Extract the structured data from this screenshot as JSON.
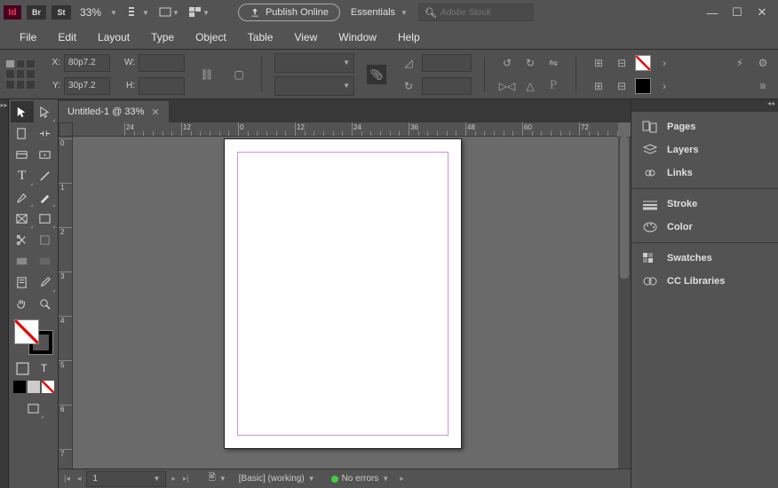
{
  "titlebar": {
    "app_id": "Id",
    "badge_br": "Br",
    "badge_st": "St",
    "zoom": "33%",
    "publish_label": "Publish Online",
    "workspace": "Essentials",
    "stock_placeholder": "Adobe Stock"
  },
  "menu": [
    "File",
    "Edit",
    "Layout",
    "Type",
    "Object",
    "Table",
    "View",
    "Window",
    "Help"
  ],
  "control": {
    "x_label": "X:",
    "y_label": "Y:",
    "w_label": "W:",
    "h_label": "H:",
    "x_value": "80p7.2",
    "y_value": "30p7.2",
    "w_value": "",
    "h_value": ""
  },
  "document": {
    "tab_title": "Untitled-1 @ 33%",
    "ruler_h_labels": [
      "24",
      "12",
      "0",
      "12",
      "24",
      "36",
      "48",
      "60",
      "72"
    ],
    "ruler_v_labels": [
      "0",
      "1",
      "2",
      "3",
      "4",
      "5",
      "6",
      "7"
    ]
  },
  "status": {
    "page_num": "1",
    "preflight": "[Basic] (working)",
    "errors": "No errors"
  },
  "panels": {
    "group1": [
      "Pages",
      "Layers",
      "Links"
    ],
    "group2": [
      "Stroke",
      "Color"
    ],
    "group3": [
      "Swatches",
      "CC Libraries"
    ]
  }
}
